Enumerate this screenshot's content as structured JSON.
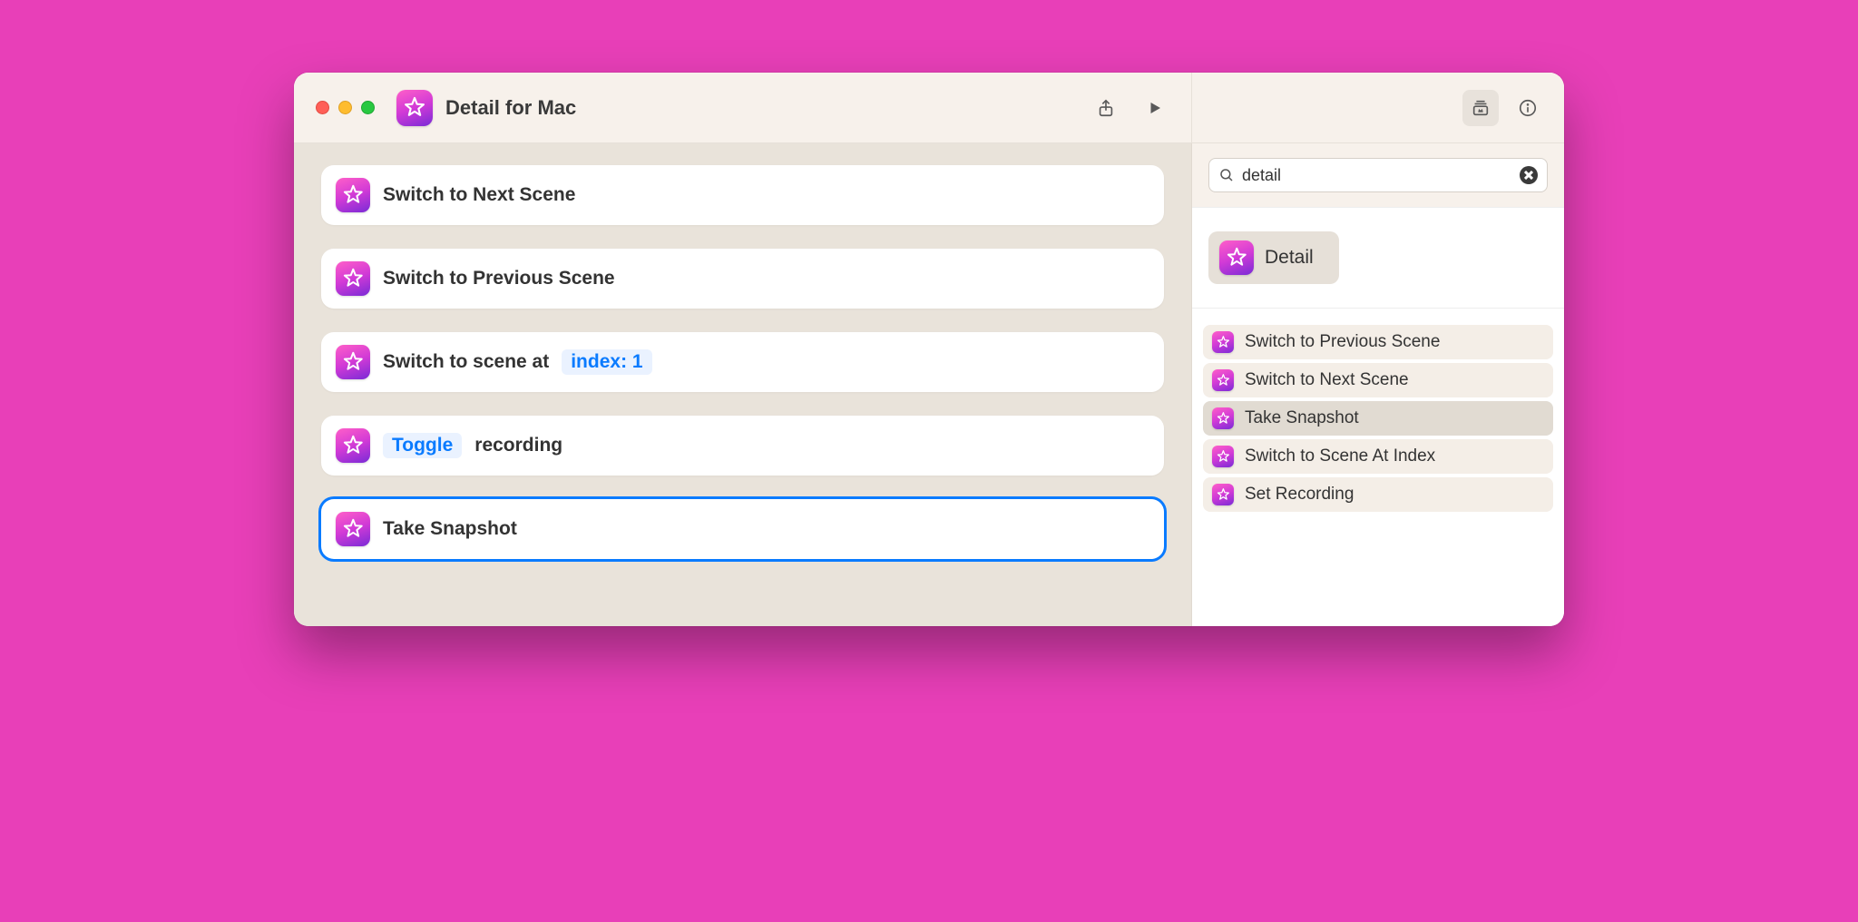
{
  "header": {
    "title": "Detail for Mac"
  },
  "actions": [
    {
      "kind": "plain",
      "label": "Switch to Next Scene"
    },
    {
      "kind": "plain",
      "label": "Switch to Previous Scene"
    },
    {
      "kind": "scene_index",
      "prefix": "Switch to scene at",
      "token": "index: 1"
    },
    {
      "kind": "recording",
      "token": "Toggle",
      "suffix": "recording"
    },
    {
      "kind": "plain",
      "label": "Take Snapshot",
      "selected": true
    }
  ],
  "search": {
    "value": "detail",
    "placeholder": "Search"
  },
  "sidebar": {
    "app_label": "Detail",
    "items": [
      {
        "label": "Switch to Previous Scene"
      },
      {
        "label": "Switch to Next Scene"
      },
      {
        "label": "Take Snapshot",
        "highlighted": true
      },
      {
        "label": "Switch to Scene At Index"
      },
      {
        "label": "Set Recording"
      }
    ]
  }
}
